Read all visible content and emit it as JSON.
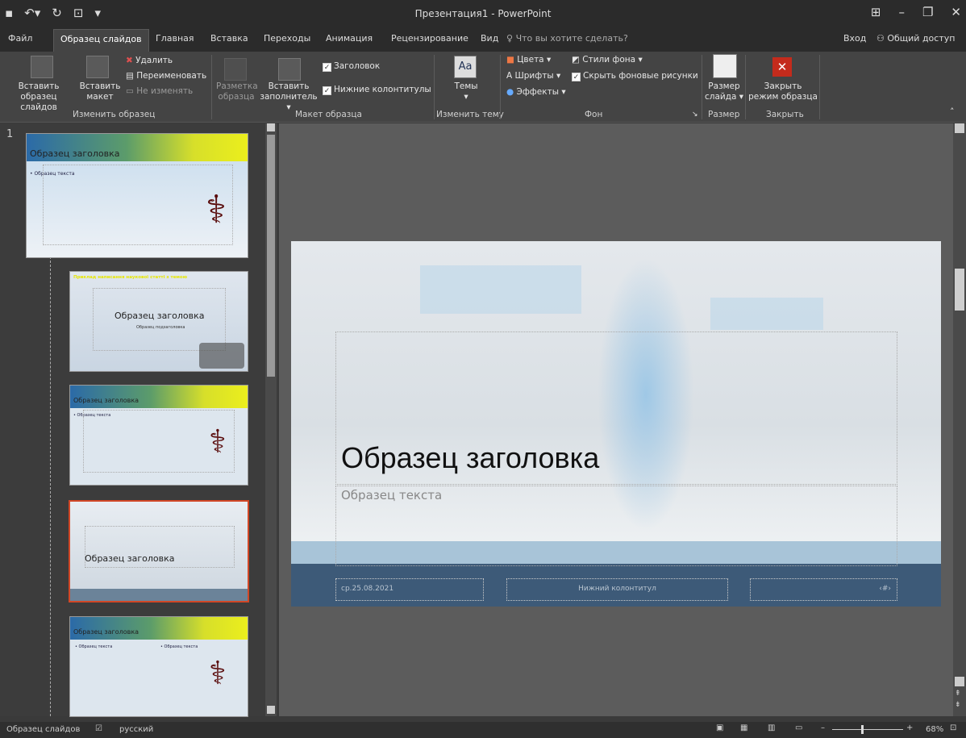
{
  "window": {
    "title": "Презентация1 - PowerPoint"
  },
  "tabs": {
    "file": "Файл",
    "master": "Образец слайдов",
    "home": "Главная",
    "insert": "Вставка",
    "transitions": "Переходы",
    "animation": "Анимация",
    "review": "Рецензирование",
    "view": "Вид",
    "tell_me": "Что вы хотите сделать?",
    "sign_in": "Вход",
    "share": "Общий доступ"
  },
  "ribbon": {
    "edit_master": {
      "insert_master": [
        "Вставить",
        "образец слайдов"
      ],
      "insert_layout": [
        "Вставить",
        "макет"
      ],
      "delete": "Удалить",
      "rename": "Переименовать",
      "preserve": "Не изменять",
      "group": "Изменить образец"
    },
    "master_layout": {
      "layout": [
        "Разметка",
        "образца"
      ],
      "insert_placeholder": [
        "Вставить",
        "заполнитель"
      ],
      "title_chk": "Заголовок",
      "footers_chk": "Нижние колонтитулы",
      "group": "Макет образца"
    },
    "edit_theme": {
      "themes": "Темы",
      "group": "Изменить тему"
    },
    "background": {
      "colors": "Цвета",
      "fonts": "Шрифты",
      "effects": "Эффекты",
      "bg_styles": "Стили фона",
      "hide_bg": "Скрыть фоновые рисунки",
      "group": "Фон"
    },
    "size": {
      "slide_size": [
        "Размер",
        "слайда"
      ],
      "group": "Размер"
    },
    "close": {
      "close_master": [
        "Закрыть",
        "режим образца"
      ],
      "group": "Закрыть"
    }
  },
  "thumbnails": {
    "number": "1",
    "t1_title": "Образец заголовка",
    "t1_text": "• Образец текста",
    "t2_header": "Приклад написання наукової статті з темою",
    "t2_title": "Образец заголовка",
    "t2_sub": "Образец подзаголовка",
    "t3_title": "Образец заголовка",
    "t3_text": "• Образец текста",
    "t4_title": "Образец заголовка",
    "t5_title": "Образец заголовка",
    "t5_text_l": "• Образец текста",
    "t5_text_r": "• Образец текста"
  },
  "slide": {
    "title": "Образец заголовка",
    "text": "Образец текста",
    "date": "ср.25.08.2021",
    "footer": "Нижний колонтитул",
    "slide_num": "‹#›"
  },
  "status": {
    "mode": "Образец слайдов",
    "lang": "русский",
    "zoom": "68%"
  },
  "colors": {
    "dark": "#2b2b2b",
    "ribbon": "#444444",
    "close_red": "#c42b1c",
    "selected_border": "#d24726"
  }
}
